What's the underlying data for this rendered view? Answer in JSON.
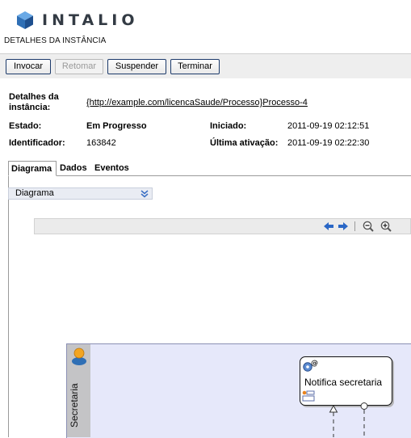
{
  "brand": {
    "name": "INTALIO",
    "logo_icon": "cube-logo-icon",
    "color": "#2f6fb5"
  },
  "page": {
    "title": "DETALHES DA INSTÂNCIA"
  },
  "toolbar": {
    "buttons": [
      {
        "label": "Invocar",
        "disabled": false
      },
      {
        "label": "Retomar",
        "disabled": true
      },
      {
        "label": "Suspender",
        "disabled": false
      },
      {
        "label": "Terminar",
        "disabled": false
      }
    ]
  },
  "details": {
    "instance_label": "Detalhes da instância:",
    "instance_value": "{http://example.com/licencaSaude/Processo}Processo-4",
    "state_label": "Estado:",
    "state_value": "Em Progresso",
    "id_label": "Identificador:",
    "id_value": "163842",
    "started_label": "Iniciado:",
    "started_value": "2011-09-19 02:12:51",
    "last_label": "Última ativação:",
    "last_value": "2011-09-19 02:22:30"
  },
  "tabs": [
    {
      "label": "Diagrama",
      "active": true
    },
    {
      "label": "Dados",
      "active": false
    },
    {
      "label": "Eventos",
      "active": false
    }
  ],
  "diagram": {
    "view_select": {
      "selected": "Diagrama",
      "icon": "double-chevron-down-icon"
    },
    "controls": [
      "arrow-left-icon",
      "arrow-right-icon",
      "zoom-out-icon",
      "zoom-in-icon"
    ],
    "lane": {
      "label": "Secretaria",
      "icon": "user-icon",
      "color": "#e6e8fa"
    },
    "task": {
      "label": "Notifica secretaria",
      "icons": [
        "service-gear-icon",
        "data-form-icon"
      ]
    }
  }
}
